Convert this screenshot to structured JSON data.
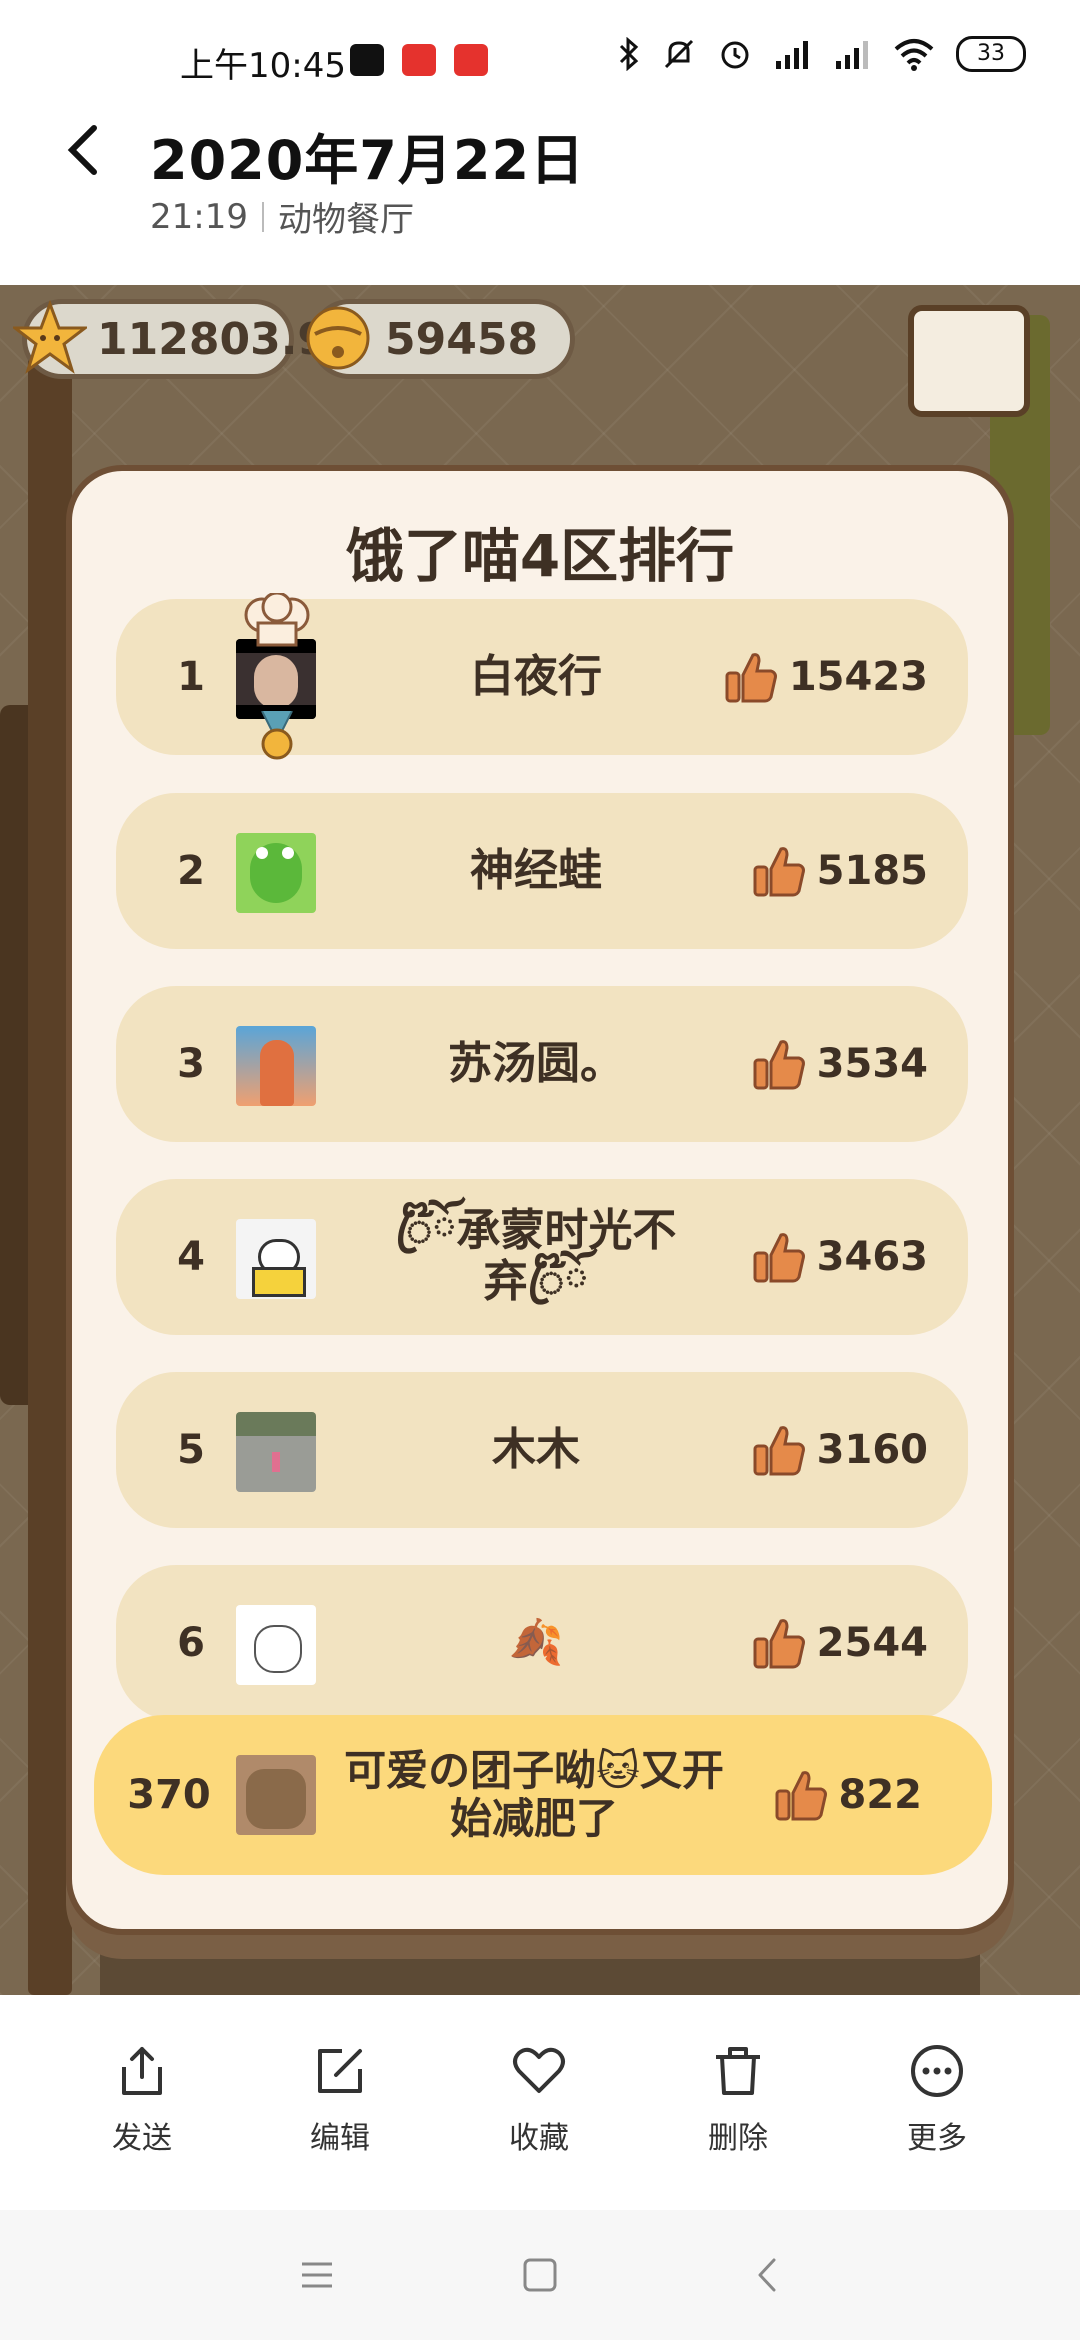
{
  "status_bar": {
    "time": "上午10:45",
    "battery": "33",
    "colors": {
      "app1": "#111111",
      "app2": "#e5322d",
      "app3": "#e5322d"
    }
  },
  "header": {
    "title": "2020年7月22日",
    "time": "21:19",
    "album": "动物餐厅"
  },
  "game": {
    "stars_value": "112803.9",
    "bells_value": "59458",
    "panel_title": "饿了喵4区排行",
    "rows": [
      {
        "rank": "1",
        "name": "白夜行",
        "likes": "15423",
        "avatar_color": "#3a3030"
      },
      {
        "rank": "2",
        "name": "神经蛙",
        "likes": "5185",
        "avatar_color": "#8fd35a"
      },
      {
        "rank": "3",
        "name": "苏汤圆。",
        "likes": "3534",
        "avatar_color": "#5aa5d8"
      },
      {
        "rank": "4",
        "name": "ꦿ໊ོ承蒙时光不弃ꦿ໊ོ",
        "likes": "3463",
        "avatar_color": "#f4f4f4"
      },
      {
        "rank": "5",
        "name": "木木",
        "likes": "3160",
        "avatar_color": "#8a8e88"
      },
      {
        "rank": "6",
        "name": "🍂",
        "likes": "2544",
        "avatar_color": "#ffffff"
      }
    ],
    "self_row": {
      "rank": "370",
      "name": "可爱の团子呦🐱又开始减肥了",
      "likes": "822",
      "avatar_color": "#b08a6a"
    },
    "colors": {
      "row_bg": "#f2e3c1",
      "self_bg": "#fcd97c",
      "thumb": "#e58a4a"
    }
  },
  "toolbar": {
    "send": "发送",
    "edit": "编辑",
    "favorite": "收藏",
    "delete": "删除",
    "more": "更多"
  }
}
